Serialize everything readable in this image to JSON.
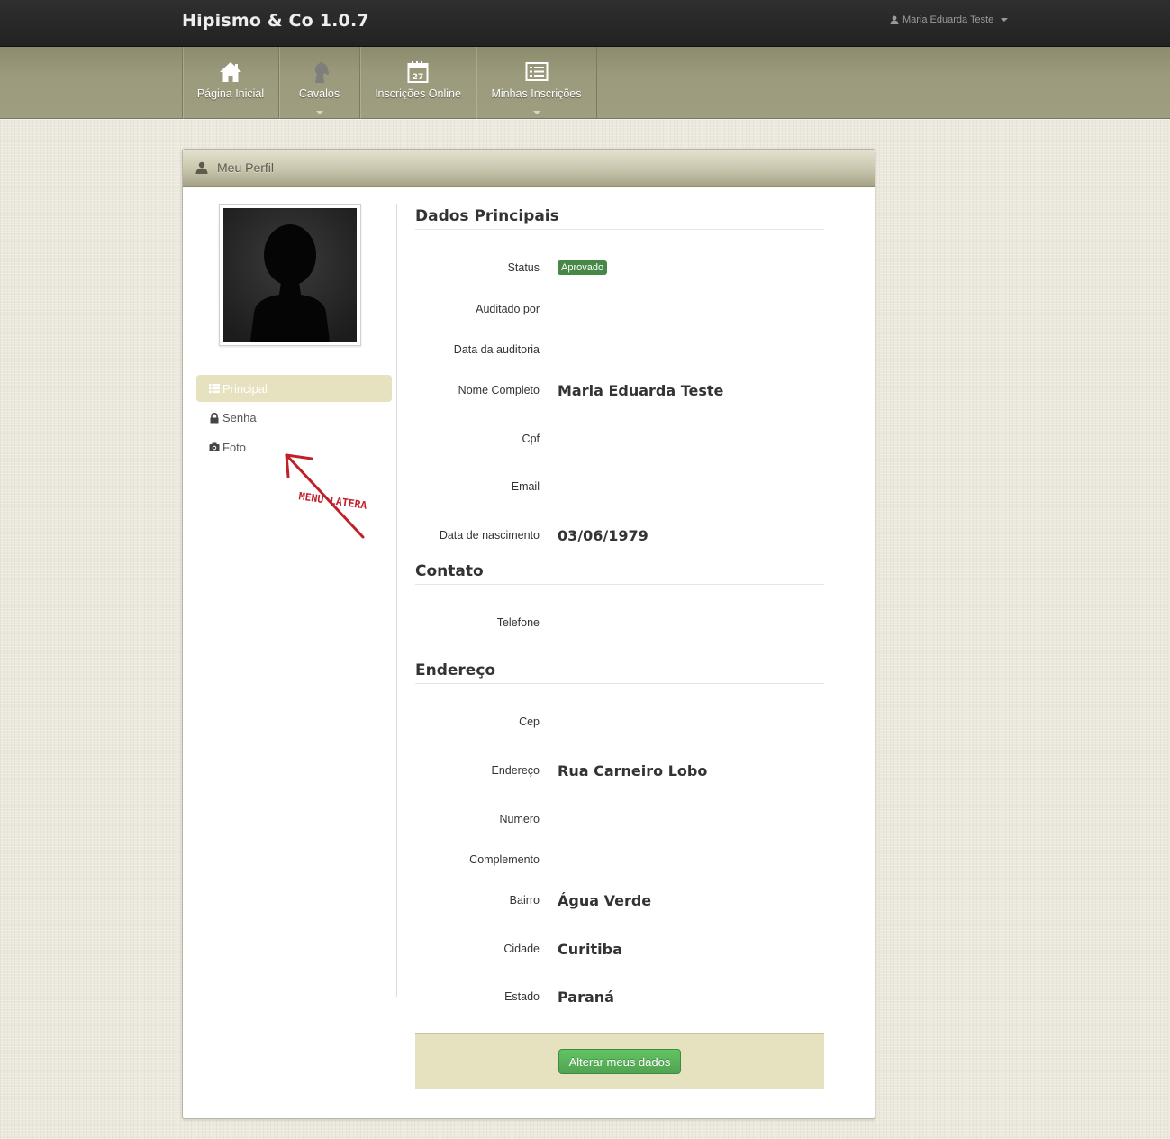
{
  "app": {
    "brand": "Hipismo & Co 1.0.7",
    "user_name": "Maria Eduarda Teste"
  },
  "nav": [
    {
      "label": "Página Inicial",
      "icon": "home-icon",
      "has_caret": false
    },
    {
      "label": "Cavalos",
      "icon": "horse-icon",
      "has_caret": true
    },
    {
      "label": "Inscrições Online",
      "icon": "calendar-icon",
      "has_caret": false,
      "calendar_day": "27"
    },
    {
      "label": "Minhas Inscrições",
      "icon": "list-icon",
      "has_caret": true
    }
  ],
  "panel": {
    "title": "Meu Perfil"
  },
  "side_menu": [
    {
      "label": "Principal",
      "icon": "list-icon",
      "active": true
    },
    {
      "label": "Senha",
      "icon": "lock-icon",
      "active": false
    },
    {
      "label": "Foto",
      "icon": "camera-icon",
      "active": false
    }
  ],
  "annotation": {
    "text": "MENU LATERAL",
    "color": "#c0202a"
  },
  "sections": {
    "principal": {
      "title": "Dados Principais",
      "status_label": "Status",
      "status_value": "Aprovado",
      "auditado_label": "Auditado por",
      "data_auditoria_label": "Data da auditoria",
      "nome_label": "Nome Completo",
      "nome_value": "Maria Eduarda Teste",
      "cpf_label": "Cpf",
      "email_label": "Email",
      "nascimento_label": "Data de nascimento",
      "nascimento_value": "03/06/1979"
    },
    "contato": {
      "title": "Contato",
      "telefone_label": "Telefone"
    },
    "endereco": {
      "title": "Endereço",
      "cep_label": "Cep",
      "endereco_label": "Endereço",
      "endereco_value": "Rua Carneiro Lobo",
      "numero_label": "Numero",
      "complemento_label": "Complemento",
      "bairro_label": "Bairro",
      "bairro_value": "Água Verde",
      "cidade_label": "Cidade",
      "cidade_value": "Curitiba",
      "estado_label": "Estado",
      "estado_value": "Paraná"
    }
  },
  "actions": {
    "edit_label": "Alterar meus dados"
  },
  "colors": {
    "status_badge": "#468847",
    "nav_bg": "#9c9a7c",
    "active_menu_bg": "#e6e2bf",
    "button": "#51a351"
  }
}
